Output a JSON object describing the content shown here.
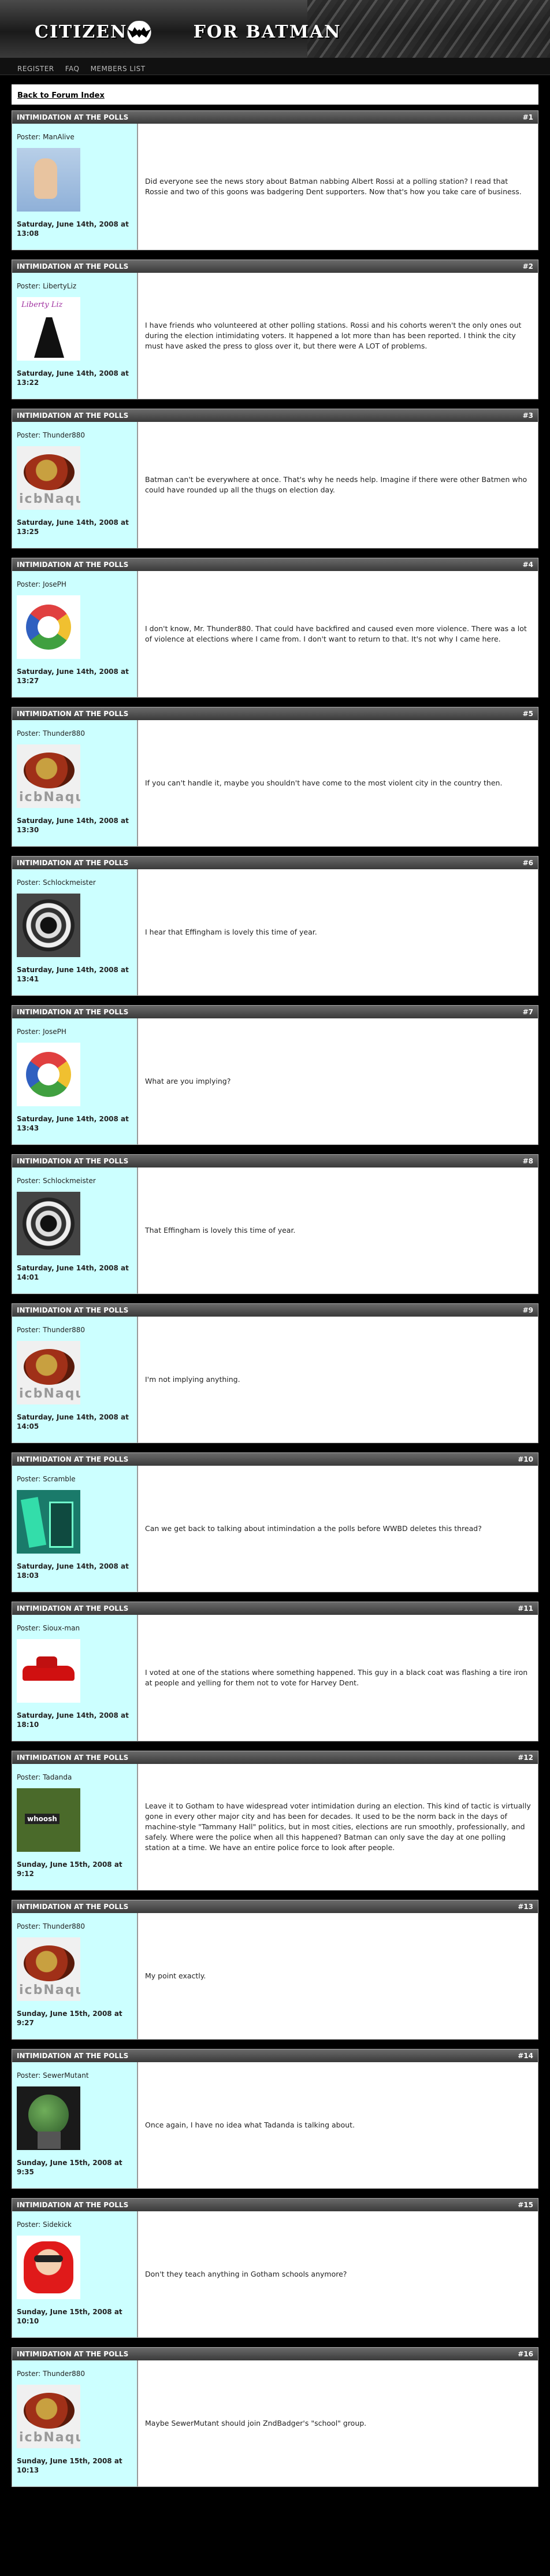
{
  "site": {
    "title_left": "CITIZENS",
    "title_right": "FOR BATMAN",
    "nav": [
      "REGISTER",
      "FAQ",
      "MEMBERS LIST"
    ]
  },
  "back_link": "Back to Forum Index",
  "posts": [
    {
      "subject": "INTIMIDATION AT THE POLLS",
      "num": "#1",
      "poster": "Poster: ManAlive",
      "date": "Saturday, June 14th, 2008 at 13:08",
      "avatar": "hand-avatar",
      "text": "Did everyone see the news story about Batman nabbing Albert Rossi at a polling station? I read that Rossie and two of this goons was badgering Dent supporters. Now that's how you take care of business."
    },
    {
      "subject": "INTIMIDATION AT THE POLLS",
      "num": "#2",
      "poster": "Poster: LibertyLiz",
      "date": "Saturday, June 14th, 2008 at 13:22",
      "avatar": "liberty-avatar",
      "avatar_label": "Liberty Liz",
      "text": "I have friends who volunteered at other polling stations. Rossi and his cohorts weren't the only ones out during the election intimidating voters. It happened a lot more than has been reported. I think the city must have asked the press to gloss over it, but there were A LOT of problems."
    },
    {
      "subject": "INTIMIDATION AT THE POLLS",
      "num": "#3",
      "poster": "Poster: Thunder880",
      "date": "Saturday, June 14th, 2008 at 13:25",
      "avatar": "chili-avatar",
      "avatar_label": "icbNaqu",
      "text": "Batman can't be everywhere at once. That's why he needs help. Imagine if there were other Batmen who could have rounded up all the thugs on election day."
    },
    {
      "subject": "INTIMIDATION AT THE POLLS",
      "num": "#4",
      "poster": "Poster: JosePH",
      "date": "Saturday, June 14th, 2008 at 13:27",
      "avatar": "joseph-avatar",
      "text": "I don't know, Mr. Thunder880. That could have backfired and caused even more violence. There was a lot of violence at elections where I came from. I don't want to return to that. It's not why I came here."
    },
    {
      "subject": "INTIMIDATION AT THE POLLS",
      "num": "#5",
      "poster": "Poster: Thunder880",
      "date": "Saturday, June 14th, 2008 at 13:30",
      "avatar": "chili-avatar",
      "avatar_label": "icbNaqu",
      "text": "If you can't handle it, maybe you shouldn't have come to the most violent city in the country then."
    },
    {
      "subject": "INTIMIDATION AT THE POLLS",
      "num": "#6",
      "poster": "Poster: Schlockmeister",
      "date": "Saturday, June 14th, 2008 at 13:41",
      "avatar": "schlock-avatar",
      "text": "I hear that Effingham is lovely this time of year."
    },
    {
      "subject": "INTIMIDATION AT THE POLLS",
      "num": "#7",
      "poster": "Poster: JosePH",
      "date": "Saturday, June 14th, 2008 at 13:43",
      "avatar": "joseph-avatar",
      "text": "What are you implying?"
    },
    {
      "subject": "INTIMIDATION AT THE POLLS",
      "num": "#8",
      "poster": "Poster: Schlockmeister",
      "date": "Saturday, June 14th, 2008 at 14:01",
      "avatar": "schlock-avatar",
      "text": "That Effingham is lovely this time of year."
    },
    {
      "subject": "INTIMIDATION AT THE POLLS",
      "num": "#9",
      "poster": "Poster: Thunder880",
      "date": "Saturday, June 14th, 2008 at 14:05",
      "avatar": "chili-avatar",
      "avatar_label": "icbNaqu",
      "text": "I'm not implying anything."
    },
    {
      "subject": "INTIMIDATION AT THE POLLS",
      "num": "#10",
      "poster": "Poster: Scramble",
      "date": "Saturday, June 14th, 2008 at 18:03",
      "avatar": "scramble-avatar",
      "text": "Can we get back to talking about intimindation a the polls before WWBD deletes this thread?"
    },
    {
      "subject": "INTIMIDATION AT THE POLLS",
      "num": "#11",
      "poster": "Poster: Sioux-man",
      "date": "Saturday, June 14th, 2008 at 18:10",
      "avatar": "car-avatar",
      "text": "I voted at one of the stations where something happened. This guy in a black coat was flashing a tire iron at people and yelling for them not to vote for Harvey Dent."
    },
    {
      "subject": "INTIMIDATION AT THE POLLS",
      "num": "#12",
      "poster": "Poster: Tadanda",
      "date": "Sunday, June 15th, 2008 at 9:12",
      "avatar": "whoosh-avatar",
      "avatar_label": "whoosh",
      "text": "Leave it to Gotham to have widespread voter intimidation during an election. This kind of tactic is virtually gone in every other major city and has been for decades. It used to be the norm back in the days of machine-style \"Tammany Hall\" politics, but in most cities, elections are run smoothly, professionally, and safely. Where were the police when all this happened? Batman can only save the day at one polling station at a time. We have an entire police force to look after people."
    },
    {
      "subject": "INTIMIDATION AT THE POLLS",
      "num": "#13",
      "poster": "Poster: Thunder880",
      "date": "Sunday, June 15th, 2008 at 9:27",
      "avatar": "chili-avatar",
      "avatar_label": "icbNaqu",
      "text": "My point exactly."
    },
    {
      "subject": "INTIMIDATION AT THE POLLS",
      "num": "#14",
      "poster": "Poster: SewerMutant",
      "date": "Sunday, June 15th, 2008 at 9:35",
      "avatar": "mutant-avatar",
      "text": "Once again, I have no idea what Tadanda is talking about."
    },
    {
      "subject": "INTIMIDATION AT THE POLLS",
      "num": "#15",
      "poster": "Poster: Sidekick",
      "date": "Sunday, June 15th, 2008 at 10:10",
      "avatar": "sidekick-avatar",
      "text": "Don't they teach anything in Gotham schools anymore?"
    },
    {
      "subject": "INTIMIDATION AT THE POLLS",
      "num": "#16",
      "poster": "Poster: Thunder880",
      "date": "Sunday, June 15th, 2008 at 10:13",
      "avatar": "chili-avatar",
      "avatar_label": "icbNaqu",
      "text": "Maybe SewerMutant should join ZndBadger's \"school\" group."
    }
  ]
}
